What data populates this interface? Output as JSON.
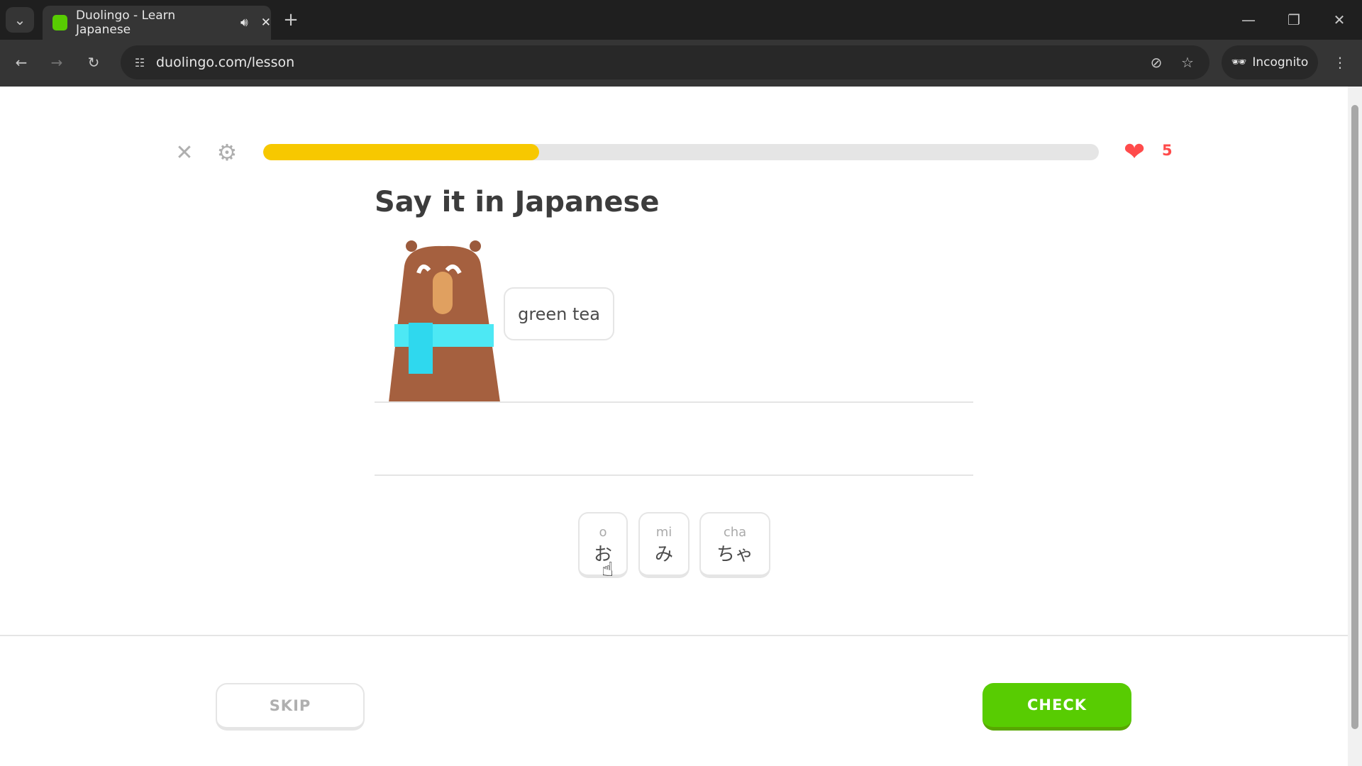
{
  "browser": {
    "tab_title": "Duolingo - Learn Japanese",
    "url": "duolingo.com/lesson",
    "incognito_label": "Incognito"
  },
  "lesson": {
    "progress_percent": 33,
    "hearts": "5",
    "title": "Say it in Japanese",
    "speech_bubble": "green tea",
    "tiles": [
      {
        "romaji": "o",
        "kana": "お"
      },
      {
        "romaji": "mi",
        "kana": "み"
      },
      {
        "romaji": "cha",
        "kana": "ちゃ"
      }
    ],
    "skip_label": "SKIP",
    "check_label": "CHECK"
  },
  "colors": {
    "progress": "#f7c800",
    "check": "#58cc02",
    "heart": "#ff4b4b"
  }
}
